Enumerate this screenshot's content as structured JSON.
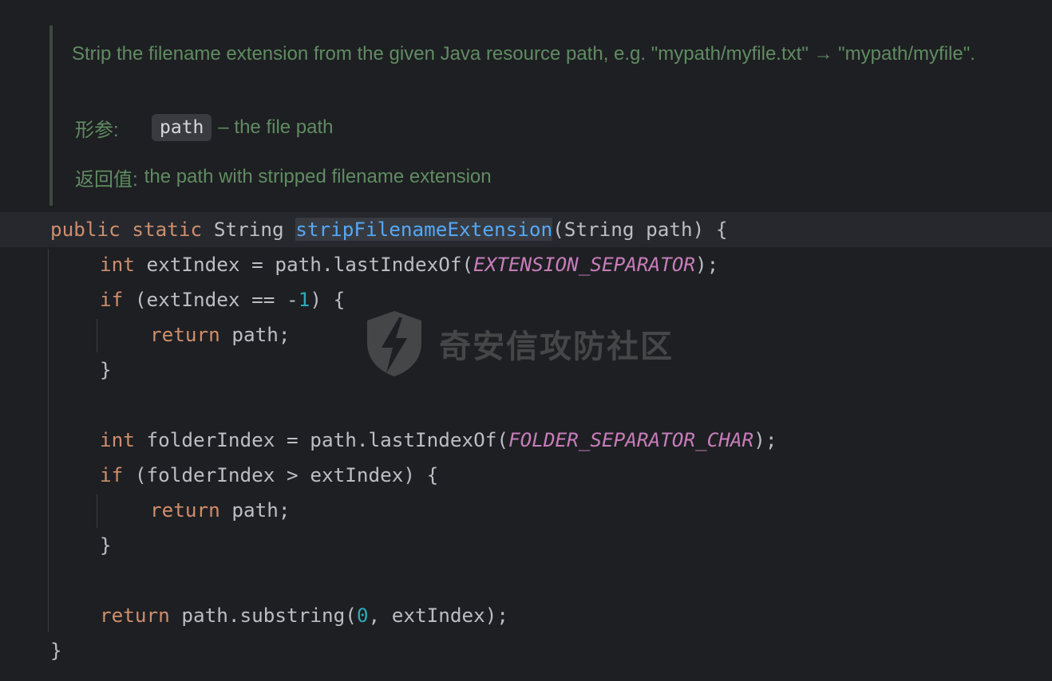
{
  "doc": {
    "description": "Strip the filename extension from the given Java resource path, e.g. \"mypath/myfile.txt\" → \"mypath/myfile\".",
    "params_label": "形参:",
    "param_name": "path",
    "param_desc": "– the file path",
    "returns_label": "返回值:",
    "returns_desc": "the path with stripped filename extension"
  },
  "code": {
    "l1": {
      "kw1": "public",
      "kw2": "static",
      "type": "String",
      "fn": "stripFilenameExtension",
      "rest": "(String path) {"
    },
    "l2": {
      "kw": "int",
      "a": " extIndex = path.lastIndexOf(",
      "const": "EXTENSION_SEPARATOR",
      "b": ");"
    },
    "l3": {
      "kw": "if",
      "a": " (extIndex == -",
      "num": "1",
      "b": ") {"
    },
    "l4": {
      "kw": "return",
      "a": " path;"
    },
    "l5": {
      "a": "}"
    },
    "l7": {
      "kw": "int",
      "a": " folderIndex = path.lastIndexOf(",
      "const": "FOLDER_SEPARATOR_CHAR",
      "b": ");"
    },
    "l8": {
      "kw": "if",
      "a": " (folderIndex > extIndex) {"
    },
    "l9": {
      "kw": "return",
      "a": " path;"
    },
    "l10": {
      "a": "}"
    },
    "l12": {
      "kw": "return",
      "a": " path.substring(",
      "num": "0",
      "b": ", extIndex);"
    },
    "l13": {
      "a": "}"
    }
  },
  "watermark": {
    "text": "奇安信攻防社区",
    "icon": "lightning-shield-icon"
  },
  "colors": {
    "background": "#1e1f22",
    "doc_text": "#5f8c62",
    "keyword": "#cf8e6d",
    "function": "#56a8f5",
    "constant": "#c77dbb",
    "number": "#2aacb8",
    "default_text": "#bcbec4"
  }
}
